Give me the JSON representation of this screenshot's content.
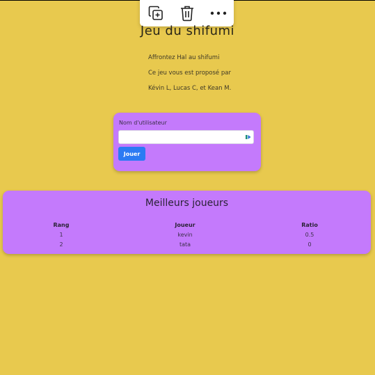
{
  "toolbar": {
    "copy_icon": "copy-add-icon",
    "delete_icon": "trash-icon",
    "more_icon": "more-horizontal-icon"
  },
  "page": {
    "title": "Jeu du shifumi",
    "intro": [
      "Affrontez Hal au shifumi",
      "Ce jeu vous est proposé par",
      "Kévin L, Lucas C, et Kean M."
    ]
  },
  "login": {
    "label": "Nom d'utilisateur",
    "value": "",
    "button": "Jouer"
  },
  "leaderboard": {
    "title": "Meilleurs joueurs",
    "headers": [
      "Rang",
      "Joueur",
      "Ratio"
    ],
    "rows": [
      [
        "1",
        "kevin",
        "0.5"
      ],
      [
        "2",
        "tata",
        "0"
      ]
    ]
  },
  "colors": {
    "background": "#e8c94e",
    "card": "#c47afc",
    "button": "#2c7bf3"
  }
}
